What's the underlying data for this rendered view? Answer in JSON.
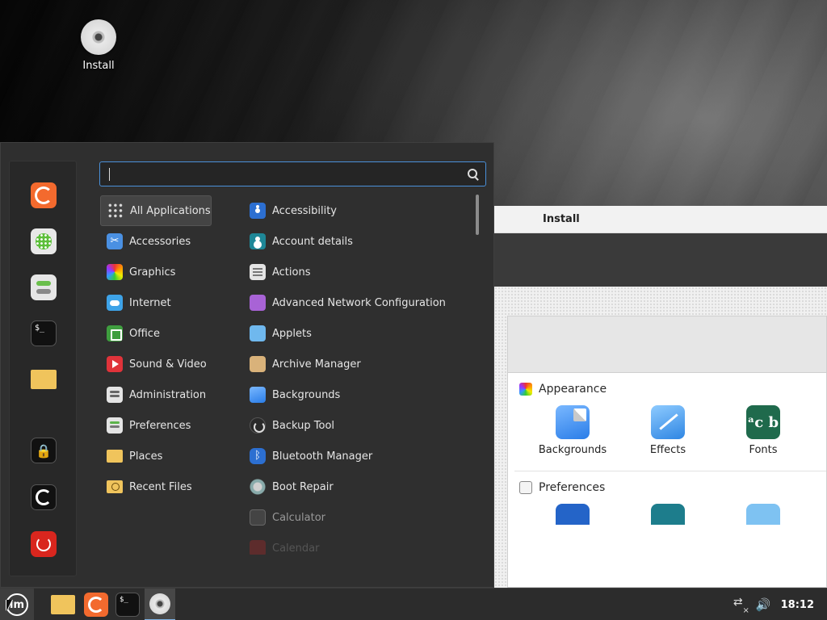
{
  "desktop": {
    "icons": [
      {
        "label": "Install",
        "icon": "disc-icon"
      }
    ]
  },
  "install_window": {
    "title": "Install",
    "sections": [
      {
        "title": "Appearance",
        "icon": "appearance-icon",
        "items": [
          {
            "label": "Backgrounds",
            "icon": "backgrounds-icon"
          },
          {
            "label": "Effects",
            "icon": "effects-icon"
          },
          {
            "label": "Fonts",
            "icon": "fonts-icon",
            "glyph": "ᵃc b"
          }
        ]
      },
      {
        "title": "Preferences",
        "icon": "preferences-icon",
        "items": [
          {
            "label": "",
            "icon": "accessibility-icon"
          },
          {
            "label": "",
            "icon": "account-details-icon"
          },
          {
            "label": "",
            "icon": "applets-icon"
          }
        ]
      }
    ]
  },
  "menu": {
    "search": {
      "value": "",
      "placeholder": ""
    },
    "favorites": [
      {
        "name": "Firefox",
        "icon": "firefox-icon"
      },
      {
        "name": "Software Manager",
        "icon": "software-manager-icon"
      },
      {
        "name": "System Settings",
        "icon": "settings-toggles-icon"
      },
      {
        "name": "Terminal",
        "icon": "terminal-icon",
        "glyph": "$_"
      },
      {
        "name": "Files",
        "icon": "folder-icon"
      },
      {
        "name": "Lock Screen",
        "icon": "lock-icon",
        "glyph": "🔒"
      },
      {
        "name": "Log Out",
        "icon": "logout-icon"
      },
      {
        "name": "Quit",
        "icon": "power-icon"
      }
    ],
    "categories": [
      {
        "label": "All Applications",
        "icon": "grid-icon",
        "selected": true
      },
      {
        "label": "Accessories",
        "icon": "accessories-icon"
      },
      {
        "label": "Graphics",
        "icon": "graphics-icon"
      },
      {
        "label": "Internet",
        "icon": "internet-icon"
      },
      {
        "label": "Office",
        "icon": "office-icon"
      },
      {
        "label": "Sound & Video",
        "icon": "sound-video-icon"
      },
      {
        "label": "Administration",
        "icon": "administration-icon"
      },
      {
        "label": "Preferences",
        "icon": "preferences-icon"
      },
      {
        "label": "Places",
        "icon": "folder-icon"
      },
      {
        "label": "Recent Files",
        "icon": "recent-files-icon"
      }
    ],
    "applications": [
      {
        "label": "Accessibility",
        "icon": "accessibility-icon"
      },
      {
        "label": "Account details",
        "icon": "account-details-icon"
      },
      {
        "label": "Actions",
        "icon": "actions-icon"
      },
      {
        "label": "Advanced Network Configuration",
        "icon": "network-config-icon"
      },
      {
        "label": "Applets",
        "icon": "applets-icon"
      },
      {
        "label": "Archive Manager",
        "icon": "archive-manager-icon"
      },
      {
        "label": "Backgrounds",
        "icon": "backgrounds-icon"
      },
      {
        "label": "Backup Tool",
        "icon": "backup-tool-icon"
      },
      {
        "label": "Bluetooth Manager",
        "icon": "bluetooth-icon"
      },
      {
        "label": "Boot Repair",
        "icon": "boot-repair-icon"
      },
      {
        "label": "Calculator",
        "icon": "calculator-icon"
      },
      {
        "label": "Calendar",
        "icon": "calendar-icon"
      }
    ]
  },
  "taskbar": {
    "menu_button": {
      "icon": "linux-mint-logo-icon",
      "glyph": "lm"
    },
    "launchers": [
      {
        "name": "Files",
        "icon": "folder-icon"
      },
      {
        "name": "Firefox",
        "icon": "firefox-icon"
      },
      {
        "name": "Terminal",
        "icon": "terminal-icon",
        "glyph": "$_"
      }
    ],
    "windows": [
      {
        "name": "Install",
        "icon": "disc-icon",
        "active": true
      }
    ],
    "tray": {
      "network_icon": "network-disconnected-icon",
      "volume_icon": "volume-icon",
      "volume_glyph": "🔊",
      "clock": "18:12"
    }
  },
  "colors": {
    "accent": "#4a90d9",
    "menu_bg": "#2f2f2f",
    "taskbar_bg": "#2c2c2c",
    "power_red": "#d9261e"
  }
}
